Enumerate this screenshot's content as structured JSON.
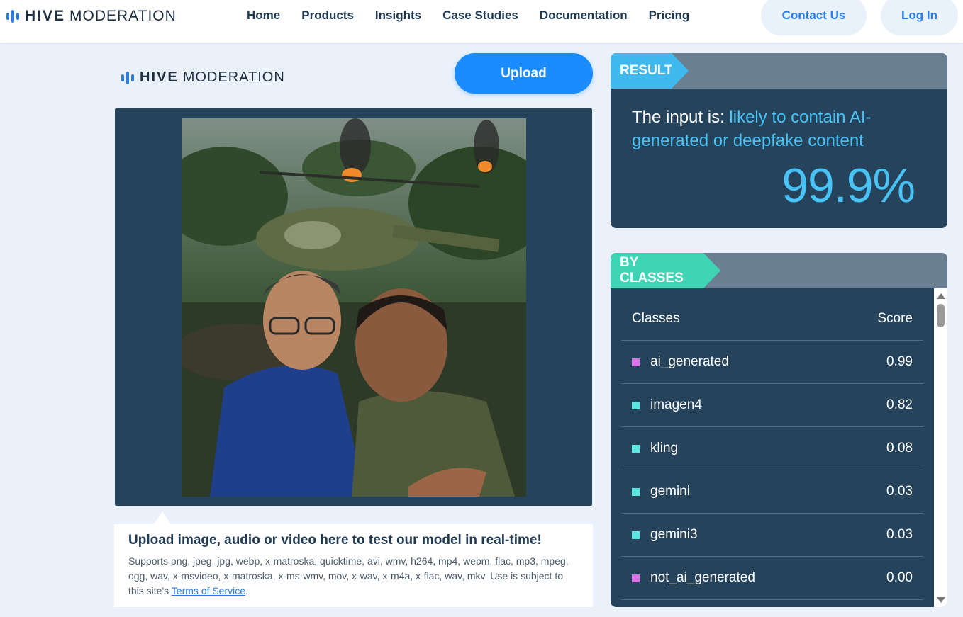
{
  "nav": {
    "brand_bold": "HIVE",
    "brand_light": "MODERATION",
    "links": [
      "Home",
      "Products",
      "Insights",
      "Case Studies",
      "Documentation",
      "Pricing"
    ],
    "contact_label": "Contact Us",
    "login_label": "Log In"
  },
  "main": {
    "brand_bold": "HIVE",
    "brand_light": "MODERATION",
    "upload_label": "Upload",
    "info_title": "Upload image, audio or video here to test our model in real-time!",
    "info_text": "Supports png, jpeg, jpg, webp, x-matroska, quicktime, avi, wmv, h264, mp4, webm, flac, mp3, mpeg, ogg, wav, x-msvideo, x-matroska, x-ms-wmv, mov, x-wav, x-m4a, x-flac, wav, mkv. Use is subject to this site's",
    "tos_link": "Terms of Service",
    "tos_suffix": "."
  },
  "result": {
    "tag": "RESULT",
    "prefix": "The input is: ",
    "verdict": "likely to contain AI-generated or deepfake content",
    "percent": "99.9%"
  },
  "classes": {
    "tag": "BY CLASSES",
    "col_class": "Classes",
    "col_score": "Score",
    "rows": [
      {
        "name": "ai_generated",
        "score": "0.99",
        "color": "#d774e8"
      },
      {
        "name": "imagen4",
        "score": "0.82",
        "color": "#5ce6e0"
      },
      {
        "name": "kling",
        "score": "0.08",
        "color": "#5ce6e0"
      },
      {
        "name": "gemini",
        "score": "0.03",
        "color": "#5ce6e0"
      },
      {
        "name": "gemini3",
        "score": "0.03",
        "color": "#5ce6e0"
      },
      {
        "name": "not_ai_generated",
        "score": "0.00",
        "color": "#d774e8"
      }
    ]
  },
  "colors": {
    "accent": "#1a8cff",
    "result_highlight": "#49c2f6",
    "panel": "#26435c"
  }
}
